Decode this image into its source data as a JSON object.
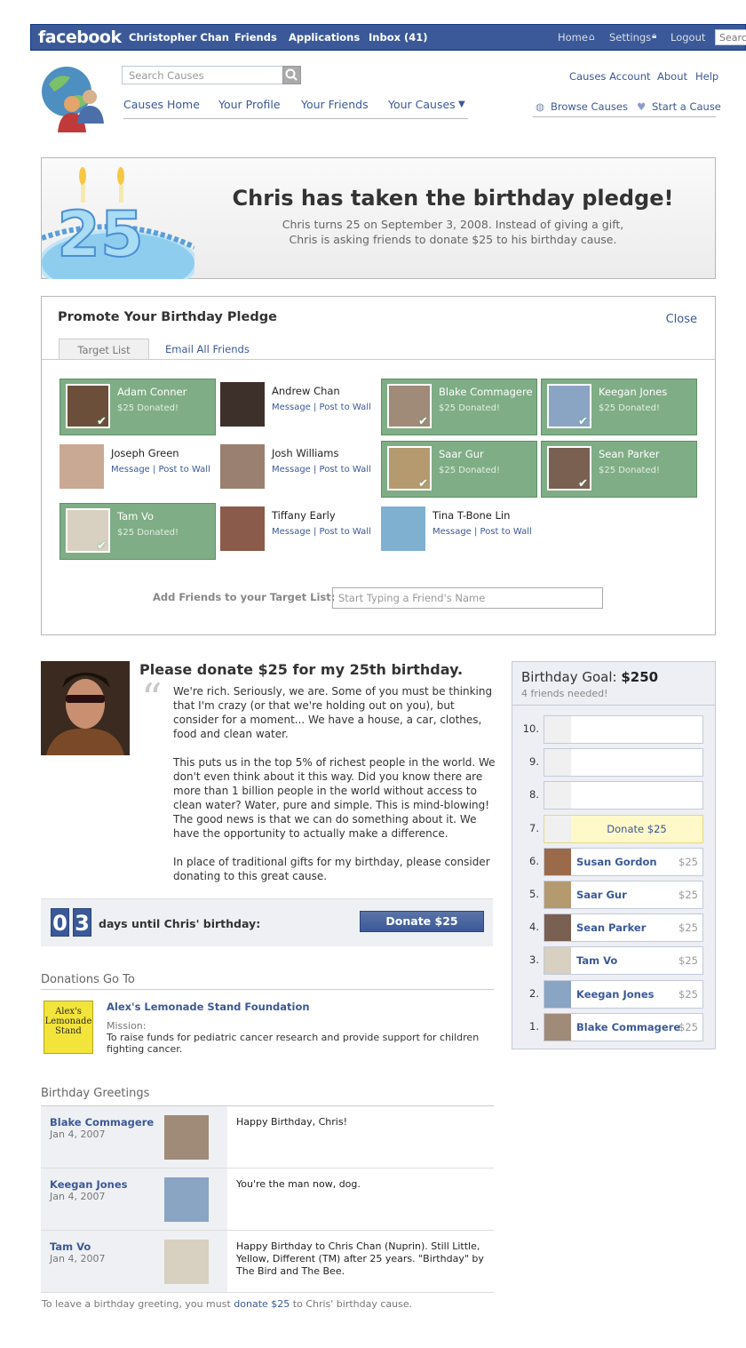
{
  "topbar": {
    "logo": "facebook",
    "left_nav": [
      "Christopher Chan",
      "Friends",
      "Applications",
      "Inbox (41)"
    ],
    "right_nav": [
      "Home",
      "Settings",
      "Logout"
    ],
    "search_placeholder": "Search"
  },
  "causes_nav": {
    "search_placeholder": "Search Causes",
    "top_links": [
      "Causes Account",
      "About",
      "Help"
    ],
    "tabs": [
      "Causes Home",
      "Your Profile",
      "Your Friends",
      "Your Causes"
    ],
    "secondary": [
      "Browse Causes",
      "Start a Cause"
    ]
  },
  "banner": {
    "age": "25",
    "title": "Chris has taken the birthday pledge!",
    "line1": "Chris turns 25 on September 3, 2008. Instead of giving a gift,",
    "line2": "Chris is asking friends to donate $25 to his birthday cause."
  },
  "promote": {
    "title": "Promote Your Birthday Pledge",
    "close": "Close",
    "tabs": [
      "Target List",
      "Email All Friends"
    ],
    "friends": [
      {
        "name": "Adam Conner",
        "status": "$25 Donated!",
        "donated": true,
        "color": "#6b4f3a"
      },
      {
        "name": "Andrew Chan",
        "status": "Message | Post to Wall",
        "donated": false,
        "color": "#3d2f2a"
      },
      {
        "name": "Blake Commagere",
        "status": "$25 Donated!",
        "donated": true,
        "color": "#a08a78"
      },
      {
        "name": "Keegan Jones",
        "status": "$25 Donated!",
        "donated": true,
        "color": "#8aa4c4"
      },
      {
        "name": "Joseph Green",
        "status": "Message | Post to Wall",
        "donated": false,
        "color": "#c9a894"
      },
      {
        "name": "Josh Williams",
        "status": "Message | Post to Wall",
        "donated": false,
        "color": "#9a8070"
      },
      {
        "name": "Saar Gur",
        "status": "$25 Donated!",
        "donated": true,
        "color": "#b59a70"
      },
      {
        "name": "Sean Parker",
        "status": "$25 Donated!",
        "donated": true,
        "color": "#7a6050"
      },
      {
        "name": "Tam Vo",
        "status": "$25 Donated!",
        "donated": true,
        "color": "#d8d0c0"
      },
      {
        "name": "Tiffany Early",
        "status": "Message | Post to Wall",
        "donated": false,
        "color": "#8a5a4a"
      },
      {
        "name": "Tina T-Bone Lin",
        "status": "Message | Post to Wall",
        "donated": false,
        "color": "#7fb0d0"
      }
    ],
    "add_label": "Add Friends to your Target List:",
    "add_placeholder": "Start Typing a Friend's Name"
  },
  "pledge": {
    "title": "Please donate $25 for my 25th birthday.",
    "quote_mark": "“",
    "paragraphs": [
      "We're rich. Seriously, we are. Some of you must be thinking that I'm crazy (or that we're holding out on you), but consider for a moment... We have a house, a car, clothes, food and clean water.",
      "This puts us in the top 5% of richest people in the world. We don't even think about it this way. Did you know there are more than 1 billion people in the world without access to clean water? Water, pure and simple. This is mind-blowing! The good news is that we can do something about it. We have the opportunity to actually make a difference.",
      "In place of traditional gifts for my birthday, please consider donating to this great cause."
    ]
  },
  "countdown": {
    "digits": [
      "0",
      "3"
    ],
    "label": "days until Chris' birthday:",
    "button": "Donate $25"
  },
  "donations": {
    "heading": "Donations Go To",
    "org_name": "Alex's Lemonade Stand Foundation",
    "logo_text": "Alex's Lemonade Stand",
    "mission_label": "Mission:",
    "mission": "To raise funds for pediatric cancer research and provide support for children fighting cancer."
  },
  "greetings": {
    "heading": "Birthday Greetings",
    "items": [
      {
        "name": "Blake Commagere",
        "date": "Jan 4, 2007",
        "text": "Happy Birthday, Chris!",
        "color": "#a08a78"
      },
      {
        "name": "Keegan Jones",
        "date": "Jan 4, 2007",
        "text": "You're the man now, dog.",
        "color": "#8aa4c4"
      },
      {
        "name": "Tam Vo",
        "date": "Jan 4, 2007",
        "text": "Happy Birthday to Chris Chan (Nuprin). Still Little, Yellow, Different (TM) after 25 years. \"Birthday\" by The Bird and The Bee.",
        "color": "#d8d0c0"
      }
    ],
    "footer_pre": "To leave a birthday greeting, you must ",
    "footer_link": "donate $25",
    "footer_post": " to Chris' birthday cause."
  },
  "goal": {
    "title_pre": "Birthday Goal: ",
    "amount": "$250",
    "subtitle": "4 friends needed!",
    "empty_slots": [
      "10.",
      "9.",
      "8."
    ],
    "cta_num": "7.",
    "cta_label": "Donate $25",
    "donors": [
      {
        "num": "6.",
        "name": "Susan Gordon",
        "amount": "$25",
        "color": "#9a6a4a"
      },
      {
        "num": "5.",
        "name": "Saar Gur",
        "amount": "$25",
        "color": "#b59a70"
      },
      {
        "num": "4.",
        "name": "Sean Parker",
        "amount": "$25",
        "color": "#7a6050"
      },
      {
        "num": "3.",
        "name": "Tam Vo",
        "amount": "$25",
        "color": "#d8d0c0"
      },
      {
        "num": "2.",
        "name": "Keegan Jones",
        "amount": "$25",
        "color": "#8aa4c4"
      },
      {
        "num": "1.",
        "name": "Blake Commagere",
        "amount": "$25",
        "color": "#a08a78"
      }
    ]
  }
}
